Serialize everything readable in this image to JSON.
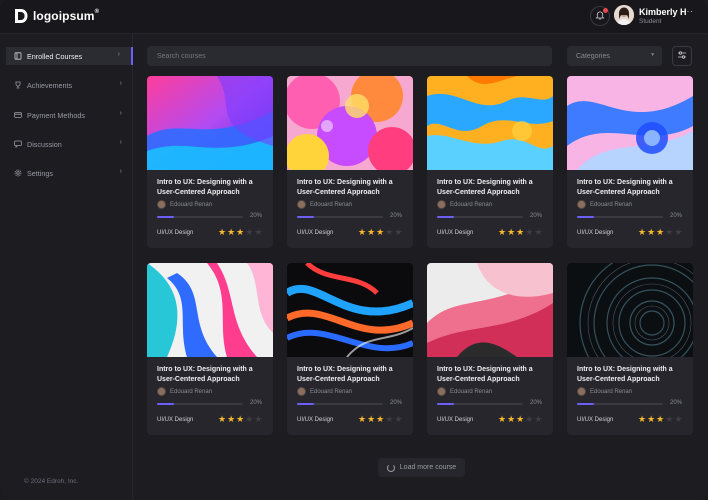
{
  "brand": {
    "name": "logoipsum",
    "mark": "®"
  },
  "user": {
    "name": "Kimberly H",
    "role": "Student",
    "more": "···"
  },
  "search": {
    "placeholder": "Search courses"
  },
  "filters": {
    "category_label": "Categories"
  },
  "sidebar": {
    "items": [
      {
        "label": "Enrolled Courses",
        "icon": "book-icon",
        "active": true
      },
      {
        "label": "Achievements",
        "icon": "trophy-icon",
        "active": false
      },
      {
        "label": "Payment Methods",
        "icon": "card-icon",
        "active": false
      },
      {
        "label": "Discussion",
        "icon": "chat-icon",
        "active": false
      },
      {
        "label": "Settings",
        "icon": "gear-icon",
        "active": false
      }
    ],
    "copyright": "© 2024 Edroh, Inc."
  },
  "courses": [
    {
      "title": "Intro to UX: Designing with a User-Centered Approach",
      "author": "Edouard Renan",
      "progress": "20%",
      "category": "UI/UX Design",
      "rating": 3,
      "max_rating": 5
    },
    {
      "title": "Intro to UX: Designing with a User-Centered Approach",
      "author": "Edouard Renan",
      "progress": "20%",
      "category": "UI/UX Design",
      "rating": 3,
      "max_rating": 5
    },
    {
      "title": "Intro to UX: Designing with a User-Centered Approach",
      "author": "Edouard Renan",
      "progress": "20%",
      "category": "UI/UX Design",
      "rating": 3,
      "max_rating": 5
    },
    {
      "title": "Intro to UX: Designing with a User-Centered Approach",
      "author": "Edouard Renan",
      "progress": "20%",
      "category": "UI/UX Design",
      "rating": 3,
      "max_rating": 5
    },
    {
      "title": "Intro to UX: Designing with a User-Centered Approach",
      "author": "Edouard Renan",
      "progress": "20%",
      "category": "UI/UX Design",
      "rating": 3,
      "max_rating": 5
    },
    {
      "title": "Intro to UX: Designing with a User-Centered Approach",
      "author": "Edouard Renan",
      "progress": "20%",
      "category": "UI/UX Design",
      "rating": 3,
      "max_rating": 5
    },
    {
      "title": "Intro to UX: Designing with a User-Centered Approach",
      "author": "Edouard Renan",
      "progress": "20%",
      "category": "UI/UX Design",
      "rating": 3,
      "max_rating": 5
    },
    {
      "title": "Intro to UX: Designing with a User-Centered Approach",
      "author": "Edouard Renan",
      "progress": "20%",
      "category": "UI/UX Design",
      "rating": 3,
      "max_rating": 5
    }
  ],
  "load_more": "Load more course",
  "colors": {
    "accent": "#6d5ef5",
    "star": "#f5b82e",
    "background": "#1c1c21",
    "card": "#26262c",
    "notification": "#e5484d"
  }
}
